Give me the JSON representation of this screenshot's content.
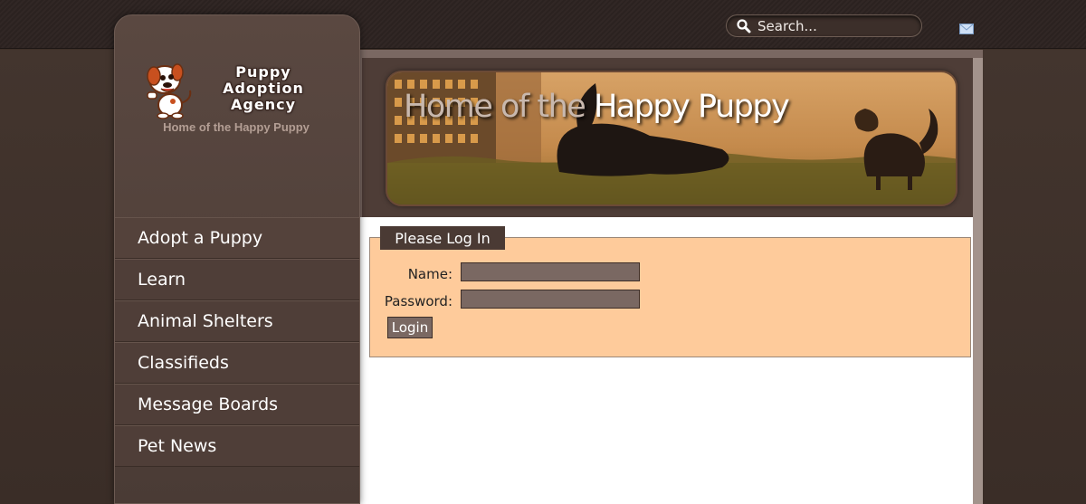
{
  "search": {
    "placeholder": "Search..."
  },
  "branding": {
    "logo_line1": "Puppy",
    "logo_line2": "Adoption",
    "logo_line3": "Agency",
    "tagline": "Home of the Happy Puppy"
  },
  "banner": {
    "title_part1": "Home of the",
    "title_part2": "Happy Puppy"
  },
  "nav": {
    "items": [
      {
        "label": "Adopt a Puppy"
      },
      {
        "label": "Learn"
      },
      {
        "label": "Animal Shelters"
      },
      {
        "label": "Classifieds"
      },
      {
        "label": "Message Boards"
      },
      {
        "label": "Pet News"
      }
    ]
  },
  "login": {
    "legend": "Please Log In",
    "name_label": "Name:",
    "password_label": "Password:",
    "name_value": "",
    "password_value": "",
    "submit_label": "Login"
  },
  "colors": {
    "topbar": "#2b2220",
    "sidebar": "#4f3e38",
    "form_bg": "#fecb9b",
    "input_bg": "#7a6862"
  },
  "icons": {
    "search": "search-icon",
    "mail": "mail-icon",
    "logo": "puppy-logo-icon"
  }
}
